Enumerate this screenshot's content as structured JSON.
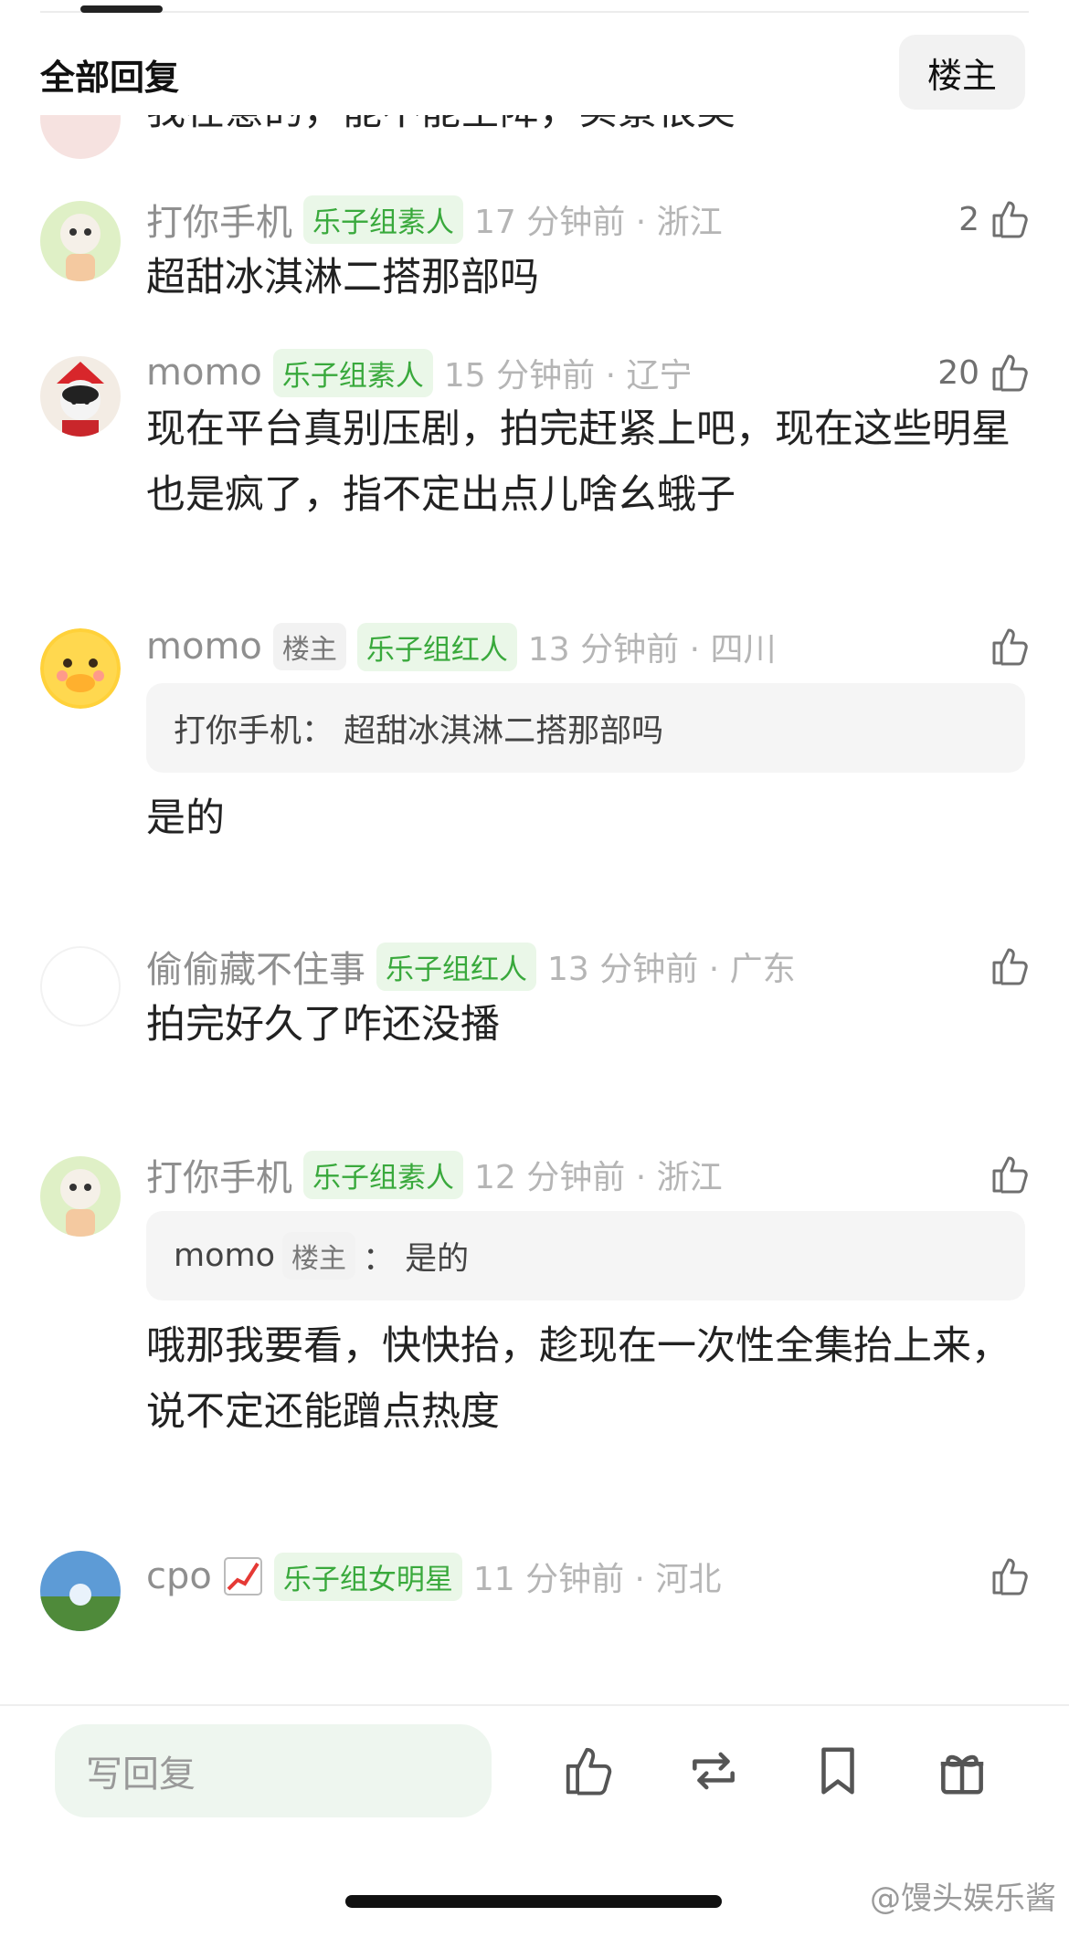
{
  "header": {
    "title": "全部回复",
    "owner_filter": "楼主"
  },
  "comments": [
    {
      "body": "我在意的，能不能空降，实景很美"
    },
    {
      "username": "打你手机",
      "badge": "乐子组素人",
      "time_loc": "17 分钟前 · 浙江",
      "likes": "2",
      "body": "超甜冰淇淋二搭那部吗"
    },
    {
      "username": "momo",
      "badge": "乐子组素人",
      "time_loc": "15 分钟前 · 辽宁",
      "likes": "20",
      "body": "现在平台真别压剧，拍完赶紧上吧，现在这些明星也是疯了，指不定出点儿啥幺蛾子"
    },
    {
      "username": "momo",
      "owner_tag": "楼主",
      "badge": "乐子组红人",
      "time_loc": "13 分钟前 · 四川",
      "quote": "打你手机：  超甜冰淇淋二搭那部吗",
      "body": "是的"
    },
    {
      "username": "偷偷藏不住事",
      "badge": "乐子组红人",
      "time_loc": "13 分钟前 · 广东",
      "body": "拍完好久了咋还没播"
    },
    {
      "username": "打你手机",
      "badge": "乐子组素人",
      "time_loc": "12 分钟前 · 浙江",
      "quote_user": "momo",
      "quote_owner_tag": "楼主",
      "quote_text": "：  是的",
      "body": "哦那我要看，快快抬，趁现在一次性全集抬上来，说不定还能蹭点热度"
    },
    {
      "username": "cpo",
      "badge": "乐子组女明星",
      "time_loc": "11 分钟前 · 河北"
    }
  ],
  "bottom_bar": {
    "reply_placeholder": "写回复"
  },
  "watermark": "@馒头娱乐酱",
  "colors": {
    "badge_green": "#39a93c",
    "badge_bg": "#eaf7e8",
    "reply_bg": "#eef6ef"
  }
}
